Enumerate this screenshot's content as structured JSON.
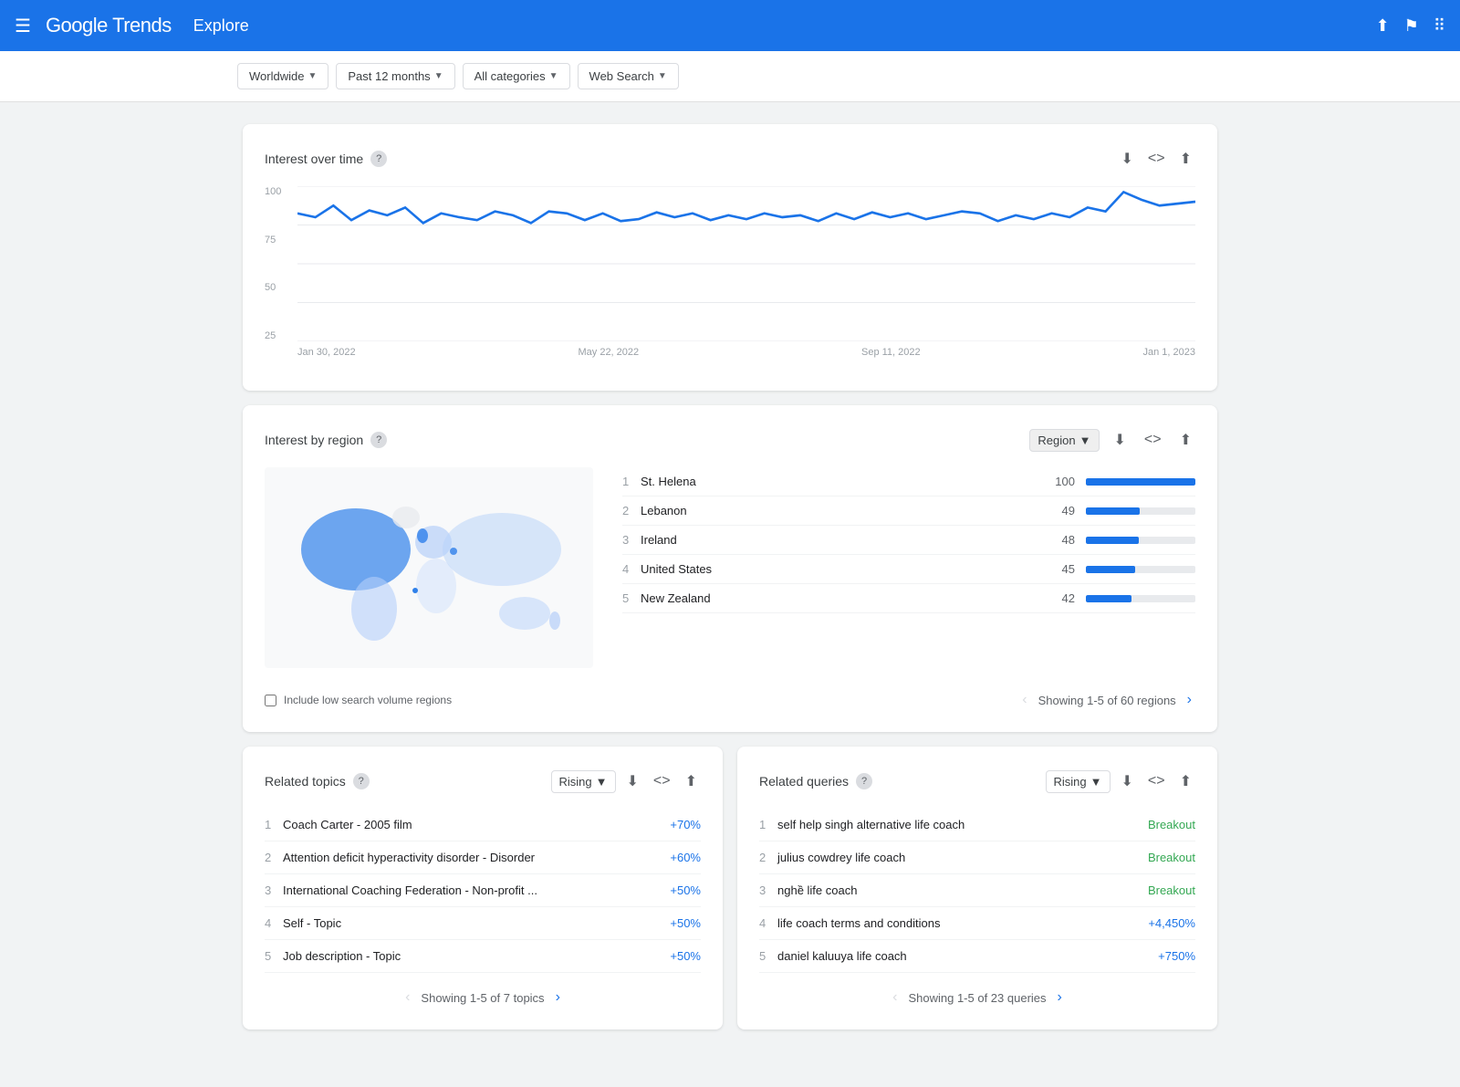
{
  "header": {
    "logo": "Google Trends",
    "explore_label": "Explore",
    "menu_icon": "☰",
    "share_icon": "⬆",
    "feedback_icon": "⚑",
    "apps_icon": "⠿"
  },
  "filters": {
    "location": "Worldwide",
    "time_range": "Past 12 months",
    "categories": "All categories",
    "search_type": "Web Search"
  },
  "interest_over_time": {
    "title": "Interest over time",
    "y_labels": [
      "100",
      "75",
      "50",
      "25"
    ],
    "x_labels": [
      "Jan 30, 2022",
      "May 22, 2022",
      "Sep 11, 2022",
      "Jan 1, 2023"
    ],
    "chart_data": [
      82,
      80,
      85,
      78,
      83,
      88,
      79,
      81,
      84,
      82,
      80,
      86,
      83,
      79,
      85,
      81,
      84,
      80,
      82,
      85,
      83,
      80,
      84,
      82,
      81,
      83,
      80,
      85,
      82,
      84,
      78,
      82,
      80,
      84,
      86,
      83,
      80,
      85,
      82,
      84,
      80,
      82,
      86,
      88,
      92,
      85,
      88,
      95,
      98
    ]
  },
  "interest_by_region": {
    "title": "Interest by region",
    "dropdown_label": "Region",
    "regions": [
      {
        "rank": 1,
        "name": "St. Helena",
        "value": 100,
        "pct": 100
      },
      {
        "rank": 2,
        "name": "Lebanon",
        "value": 49,
        "pct": 49
      },
      {
        "rank": 3,
        "name": "Ireland",
        "value": 48,
        "pct": 48
      },
      {
        "rank": 4,
        "name": "United States",
        "value": 45,
        "pct": 45
      },
      {
        "rank": 5,
        "name": "New Zealand",
        "value": 42,
        "pct": 42
      }
    ],
    "checkbox_label": "Include low search volume regions",
    "pagination_text": "Showing 1-5 of 60 regions"
  },
  "related_topics": {
    "title": "Related topics",
    "rising_label": "Rising",
    "topics": [
      {
        "rank": 1,
        "name": "Coach Carter - 2005 film",
        "value": "+70%"
      },
      {
        "rank": 2,
        "name": "Attention deficit hyperactivity disorder - Disorder",
        "value": "+60%"
      },
      {
        "rank": 3,
        "name": "International Coaching Federation - Non-profit ...",
        "value": "+50%"
      },
      {
        "rank": 4,
        "name": "Self - Topic",
        "value": "+50%"
      },
      {
        "rank": 5,
        "name": "Job description - Topic",
        "value": "+50%"
      }
    ],
    "pagination_text": "Showing 1-5 of 7 topics"
  },
  "related_queries": {
    "title": "Related queries",
    "rising_label": "Rising",
    "queries": [
      {
        "rank": 1,
        "name": "self help singh alternative life coach",
        "value": "Breakout",
        "is_breakout": true
      },
      {
        "rank": 2,
        "name": "julius cowdrey life coach",
        "value": "Breakout",
        "is_breakout": true
      },
      {
        "rank": 3,
        "name": "nghề life coach",
        "value": "Breakout",
        "is_breakout": true
      },
      {
        "rank": 4,
        "name": "life coach terms and conditions",
        "value": "+4,450%",
        "is_breakout": false
      },
      {
        "rank": 5,
        "name": "daniel kaluuya life coach",
        "value": "+750%",
        "is_breakout": false
      }
    ],
    "pagination_text": "Showing 1-5 of 23 queries"
  }
}
